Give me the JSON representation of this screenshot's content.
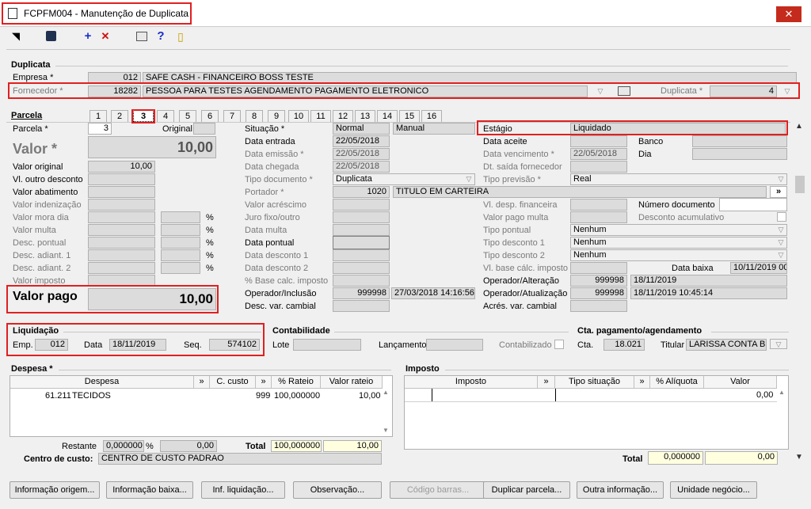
{
  "window": {
    "title": "FCPFM004 - Manutenção de Duplicata",
    "close": "✕"
  },
  "toolbar": {
    "plus": "+",
    "cross": "✕",
    "help": "?"
  },
  "duplicata": {
    "group": "Duplicata",
    "empresa_label": "Empresa *",
    "empresa_code": "012",
    "empresa_name": "SAFE CASH - FINANCEIRO BOSS TESTE",
    "fornecedor_label": "Fornecedor *",
    "fornecedor_code": "18282",
    "fornecedor_name": "PESSOA PARA TESTES AGENDAMENTO PAGAMENTO ELETRONICO",
    "duplicata_label": "Duplicata *",
    "duplicata_value": "4"
  },
  "parcela": {
    "group": "Parcela",
    "tabs": [
      "1",
      "2",
      "3",
      "4",
      "5",
      "6",
      "7",
      "8",
      "9",
      "10",
      "11",
      "12",
      "13",
      "14",
      "15",
      "16"
    ],
    "parcela_label": "Parcela *",
    "parcela_value": "3",
    "original_label": "Original",
    "valor_label": "Valor *",
    "valor_value": "10,00",
    "valor_original_label": "Valor original",
    "valor_original_value": "10,00",
    "vl_outro_desconto": "Vl. outro desconto",
    "valor_abatimento": "Valor abatimento",
    "valor_indenizacao": "Valor indenização",
    "valor_mora_dia": "Valor mora dia",
    "valor_multa": "Valor multa",
    "desc_pontual": "Desc. pontual",
    "desc_adiant1": "Desc. adiant. 1",
    "desc_adiant2": "Desc. adiant. 2",
    "valor_imposto": "Valor imposto",
    "pct": "%",
    "valor_pago_label": "Valor pago",
    "valor_pago_value": "10,00",
    "situacao_label": "Situação *",
    "situacao_value": "Normal",
    "situacao_value2": "Manual",
    "data_entrada_label": "Data entrada",
    "data_entrada_value": "22/05/2018",
    "data_emissao_label": "Data emissão *",
    "data_emissao_value": "22/05/2018",
    "data_chegada_label": "Data chegada",
    "data_chegada_value": "22/05/2018",
    "tipo_documento_label": "Tipo documento *",
    "tipo_documento_value": "Duplicata",
    "portador_label": "Portador *",
    "portador_code": "1020",
    "portador_name": "TITULO EM CARTEIRA",
    "portador_btn": "»",
    "valor_acrescimo": "Valor acréscimo",
    "juro_fixo": "Juro fixo/outro",
    "data_multa": "Data multa",
    "data_pontual": "Data pontual",
    "data_desconto1": "Data desconto 1",
    "data_desconto2": "Data desconto 2",
    "base_calc": "% Base calc. imposto",
    "op_inclusao_label": "Operador/Inclusão",
    "op_inclusao_code": "999998",
    "op_inclusao_date": "27/03/2018 14:16:56",
    "desc_var_cambial": "Desc. var. cambial",
    "estagio_label": "Estágio",
    "estagio_value": "Liquidado",
    "data_aceite": "Data aceite",
    "data_vencimento_label": "Data vencimento *",
    "data_vencimento_value": "22/05/2018",
    "dt_saida_fornecedor": "Dt. saída fornecedor",
    "tipo_previsao_label": "Tipo previsão *",
    "tipo_previsao_value": "Real",
    "vl_desp_financeira": "Vl. desp. financeira",
    "valor_pago_multa": "Valor pago multa",
    "tipo_pontual_label": "Tipo pontual",
    "tipo_pontual_value": "Nenhum",
    "tipo_desconto1_label": "Tipo desconto 1",
    "tipo_desconto1_value": "Nenhum",
    "tipo_desconto2_label": "Tipo desconto 2",
    "tipo_desconto2_value": "Nenhum",
    "vl_base_calc": "Vl. base cálc. imposto",
    "op_alteracao_label": "Operador/Alteração",
    "op_alteracao_code": "999998",
    "op_alteracao_date": "18/11/2019",
    "op_atualizacao_label": "Operador/Atualização",
    "op_atualizacao_code": "999998",
    "op_atualizacao_date": "18/11/2019 10:45:14",
    "acres_var_cambial": "Acrés. var. cambial",
    "banco": "Banco",
    "dia": "Dia",
    "numero_documento": "Número documento",
    "desconto_acumulativo": "Desconto acumulativo",
    "data_baixa_label": "Data baixa",
    "data_baixa_value": "10/11/2019 00"
  },
  "liquidacao": {
    "group": "Liquidação",
    "emp_label": "Emp.",
    "emp_value": "012",
    "data_label": "Data",
    "data_value": "18/11/2019",
    "seq_label": "Seq.",
    "seq_value": "574102"
  },
  "contabilidade": {
    "group": "Contabilidade",
    "lote_label": "Lote",
    "lancamento_label": "Lançamento",
    "contabilizado_label": "Contabilizado"
  },
  "cta": {
    "group": "Cta. pagamento/agendamento",
    "cta_label": "Cta.",
    "cta_value": "18.021",
    "titular_label": "Titular",
    "titular_value": "LARISSA CONTA BE"
  },
  "despesa": {
    "group": "Despesa *",
    "headers": [
      "Despesa",
      "»",
      "C. custo",
      "»",
      "% Rateio",
      "Valor rateio"
    ],
    "row": {
      "code": "61.211",
      "name": "TECIDOS",
      "ccusto": "999",
      "rateio": "100,000000",
      "valor": "10,00"
    },
    "restante_label": "Restante",
    "restante_pct": "0,000000",
    "restante_pct_sign": "%",
    "restante_val": "0,00",
    "total_label": "Total",
    "total_pct": "100,000000",
    "total_val": "10,00",
    "centro_label": "Centro de custo:",
    "centro_value": "CENTRO DE CUSTO PADRAO"
  },
  "imposto": {
    "group": "Imposto",
    "headers": [
      "Imposto",
      "»",
      "Tipo situação",
      "»",
      "% Alíquota",
      "Valor"
    ],
    "row_valor": "0,00",
    "total_label": "Total",
    "total_pct": "0,000000",
    "total_val": "0,00"
  },
  "buttons": [
    "Informação origem...",
    "Informação baixa...",
    "Inf. liquidação...",
    "Observação...",
    "Código barras...",
    "Duplicar parcela...",
    "Outra informação...",
    "Unidade negócio..."
  ]
}
